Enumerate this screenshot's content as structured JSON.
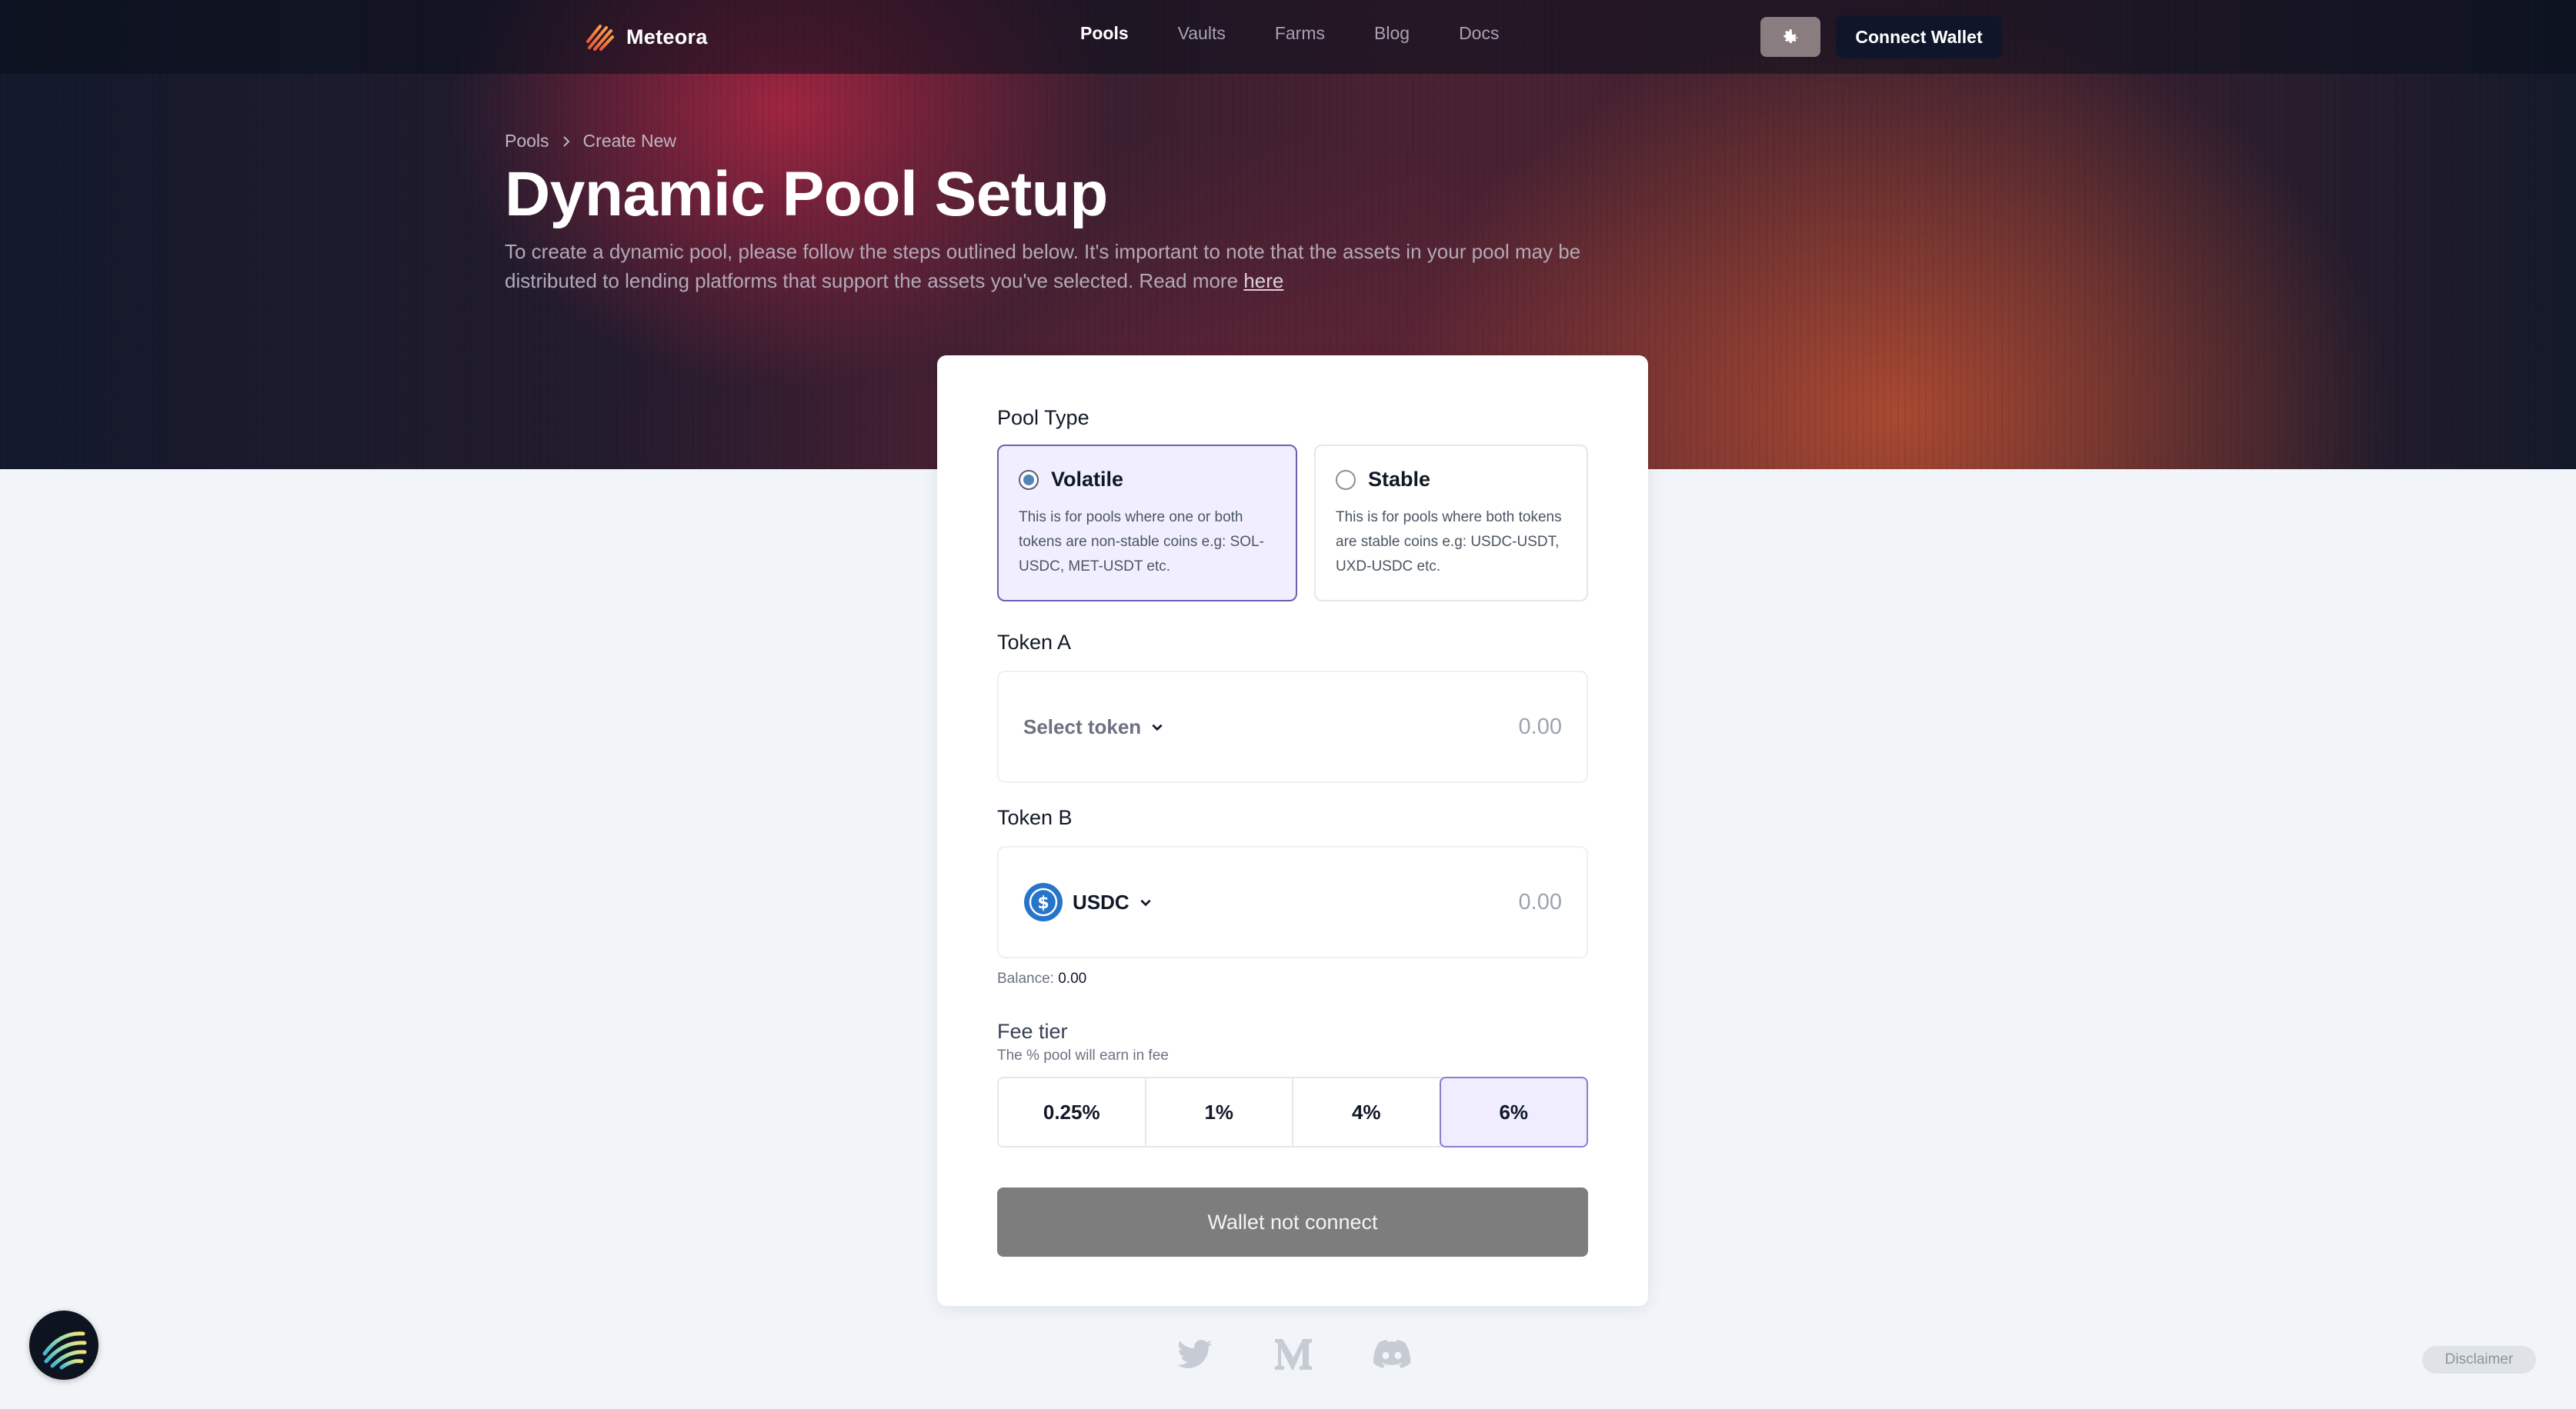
{
  "brand": {
    "name": "Meteora"
  },
  "nav": {
    "items": [
      {
        "label": "Pools",
        "active": true
      },
      {
        "label": "Vaults",
        "active": false
      },
      {
        "label": "Farms",
        "active": false
      },
      {
        "label": "Blog",
        "active": false
      },
      {
        "label": "Docs",
        "active": false
      }
    ]
  },
  "header": {
    "settings_icon": "gear-icon",
    "connect_label": "Connect Wallet"
  },
  "breadcrumb": {
    "root": "Pools",
    "current": "Create New"
  },
  "page": {
    "title": "Dynamic Pool Setup",
    "description": "To create a dynamic pool, please follow the steps outlined below. It's important to note that the assets in your pool may be distributed to lending platforms that support the assets you've selected. Read more",
    "link_label": "here"
  },
  "form": {
    "pool_type_label": "Pool Type",
    "pool_types": [
      {
        "title": "Volatile",
        "desc": "This is for pools where one or both tokens are non-stable coins e.g: SOL-USDC, MET-USDT etc.",
        "selected": true
      },
      {
        "title": "Stable",
        "desc": "This is for pools where both tokens are stable coins e.g: USDC-USDT, UXD-USDC etc.",
        "selected": false
      }
    ],
    "token_a": {
      "label": "Token A",
      "placeholder": "Select token",
      "amount": "0.00"
    },
    "token_b": {
      "label": "Token B",
      "symbol": "USDC",
      "amount": "0.00",
      "balance_label": "Balance:",
      "balance_value": "0.00"
    },
    "fee": {
      "title": "Fee tier",
      "subtitle": "The % pool will earn in fee",
      "options": [
        "0.25%",
        "1%",
        "4%",
        "6%"
      ],
      "selected": "6%"
    },
    "submit_label": "Wallet not connect"
  },
  "footer": {
    "socials": [
      "twitter-icon",
      "medium-icon",
      "discord-icon"
    ],
    "disclaimer": "Disclaimer"
  },
  "colors": {
    "accent": "#6b5fb0",
    "selected_bg": "#f1efff",
    "usdc": "#2775ca",
    "dark_btn": "#101629"
  }
}
